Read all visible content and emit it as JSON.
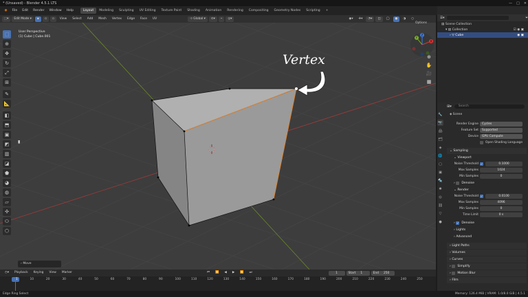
{
  "title_bar": {
    "title": "* (Unsaved) - Blender 4.5.1 LTS"
  },
  "menu": [
    "File",
    "Edit",
    "Render",
    "Window",
    "Help"
  ],
  "workspaces": [
    {
      "label": "Layout",
      "active": true
    },
    {
      "label": "Modeling"
    },
    {
      "label": "Sculpting"
    },
    {
      "label": "UV Editing"
    },
    {
      "label": "Texture Paint"
    },
    {
      "label": "Shading"
    },
    {
      "label": "Animation"
    },
    {
      "label": "Rendering"
    },
    {
      "label": "Compositing"
    },
    {
      "label": "Geometry Nodes"
    },
    {
      "label": "Scripting"
    },
    {
      "label": "+"
    }
  ],
  "scene_selector": {
    "label": "Scene",
    "view_layer": "ViewLayer"
  },
  "viewport_header": {
    "mode": "Edit Mode",
    "menus": [
      "View",
      "Select",
      "Add",
      "Mesh",
      "Vertex",
      "Edge",
      "Face",
      "UV"
    ],
    "transform_orientation": "Global",
    "options": "Options"
  },
  "viewport": {
    "perspective": "User Perspective",
    "object_info": "(1) Cube | Cube.001",
    "annotation": "Vertex",
    "last_operator": "Move",
    "gizmo_axes": {
      "x": "X",
      "y": "Y",
      "z": "Z"
    }
  },
  "timeline": {
    "menus": [
      "Playback",
      "Keying",
      "View",
      "Marker"
    ],
    "current_frame": "1",
    "start_label": "Start",
    "start": "1",
    "end_label": "End",
    "end": "250",
    "ruler": [
      "1",
      "10",
      "20",
      "30",
      "40",
      "50",
      "60",
      "70",
      "80",
      "90",
      "100",
      "110",
      "120",
      "130",
      "140",
      "150",
      "160",
      "170",
      "180",
      "190",
      "200",
      "210",
      "220",
      "230",
      "240",
      "250"
    ]
  },
  "status_bar": {
    "left": "Edge Ring Select",
    "right": "Memory: 126.4 MiB | VRAM: 1.0/8.0 GiB | 4.5.1"
  },
  "outliner": {
    "scene_collection": "Scene Collection",
    "collection": "Collection",
    "cube": "Cube"
  },
  "properties": {
    "scene": "Scene",
    "search_placeholder": "Search",
    "render_engine_label": "Render Engine",
    "render_engine": "Cycles",
    "feature_set_label": "Feature Set",
    "feature_set": "Supported",
    "device_label": "Device",
    "device": "GPU Compute",
    "osl": "Open Shading Language",
    "sampling": "Sampling",
    "viewport": "Viewport",
    "noise_threshold_label": "Noise Threshold",
    "viewport_noise": "0.1000",
    "max_samples_label": "Max Samples",
    "viewport_max": "1024",
    "min_samples_label": "Min Samples",
    "viewport_min": "0",
    "denoise": "Denoise",
    "render": "Render",
    "render_noise": "0.0100",
    "render_max": "4096",
    "render_min": "0",
    "time_limit_label": "Time Limit",
    "time_limit": "0 s",
    "denoise2": "Denoise",
    "lights": "Lights",
    "advanced": "Advanced",
    "light_paths": "Light Paths",
    "volumes": "Volumes",
    "curves": "Curves",
    "simplify": "Simplify",
    "motion_blur": "Motion Blur",
    "film": "Film"
  }
}
